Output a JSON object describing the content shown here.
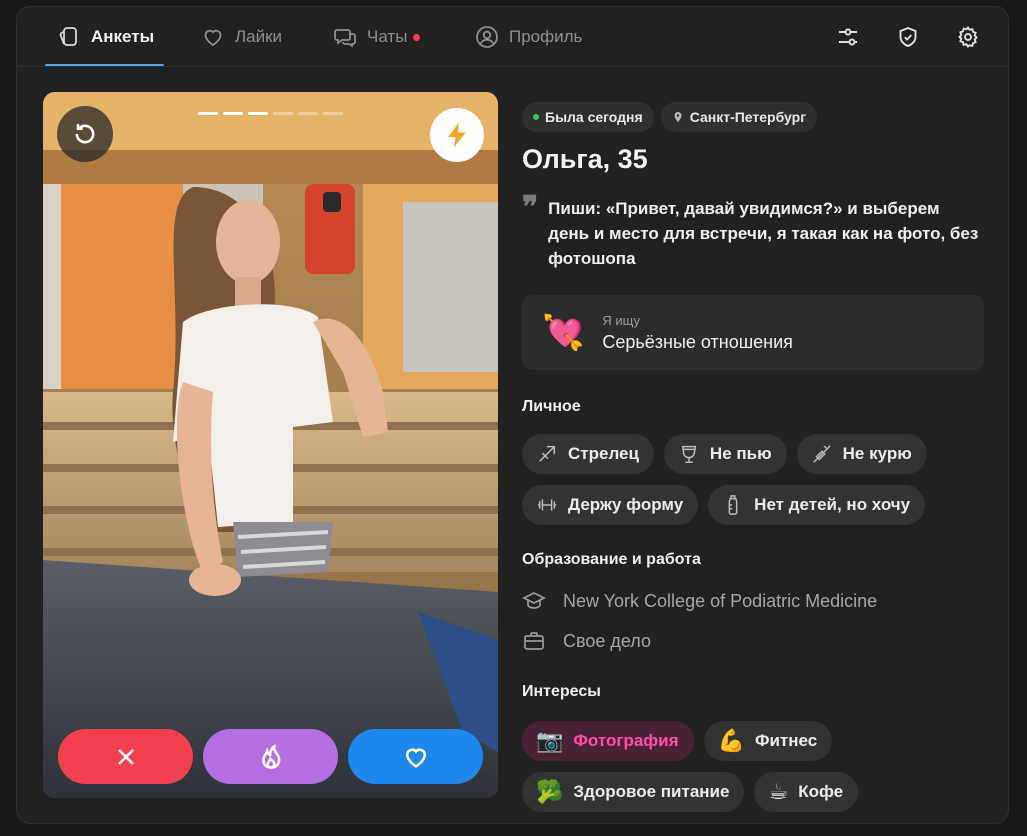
{
  "nav": {
    "tabs": [
      {
        "label": "Анкеты",
        "icon": "cards-icon",
        "active": true
      },
      {
        "label": "Лайки",
        "icon": "heart-icon",
        "active": false
      },
      {
        "label": "Чаты",
        "icon": "chat-icon",
        "active": false,
        "has_notification": true
      },
      {
        "label": "Профиль",
        "icon": "profile-icon",
        "active": false
      }
    ],
    "actions": [
      "filters-icon",
      "shield-icon",
      "gear-icon"
    ],
    "accent": "#5aa3e8"
  },
  "photo": {
    "current_index": 3,
    "total": 6,
    "undo_icon": "undo-icon",
    "boost_icon": "lightning-icon"
  },
  "actions": {
    "dislike": {
      "icon": "close-icon",
      "color": "#f2404f"
    },
    "superlike": {
      "icon": "flame-icon",
      "color": "#b66fe0"
    },
    "like": {
      "icon": "heart-icon",
      "color": "#1f88f0"
    }
  },
  "profile": {
    "status": "Была сегодня",
    "city": "Санкт-Петербург",
    "name_age": "Ольга, 35",
    "quote": "Пиши: «Привет, давай увидимся?» и выберем день и место для встречи, я такая как на фото, без фотошопа",
    "seeking": {
      "label": "Я ищу",
      "value": "Серьёзные отношения",
      "icon": "💘"
    },
    "personal_title": "Личное",
    "personal": [
      {
        "label": "Стрелец",
        "icon": "arrow-icon"
      },
      {
        "label": "Не пью",
        "icon": "glass-icon"
      },
      {
        "label": "Не курю",
        "icon": "no-smoking-icon"
      },
      {
        "label": "Держу форму",
        "icon": "dumbbell-icon"
      },
      {
        "label": "Нет детей, но хочу",
        "icon": "bottle-icon"
      }
    ],
    "education_title": "Образование и работа",
    "education": "New York College of Podiatric Medicine",
    "work": "Свое дело",
    "interests_title": "Интересы",
    "interests": [
      {
        "label": "Фотография",
        "emoji": "📷",
        "highlighted": true
      },
      {
        "label": "Фитнес",
        "emoji": "💪",
        "highlighted": false
      },
      {
        "label": "Здоровое питание",
        "emoji": "🥦",
        "highlighted": false
      },
      {
        "label": "Кофе",
        "emoji": "☕",
        "highlighted": false
      }
    ]
  }
}
